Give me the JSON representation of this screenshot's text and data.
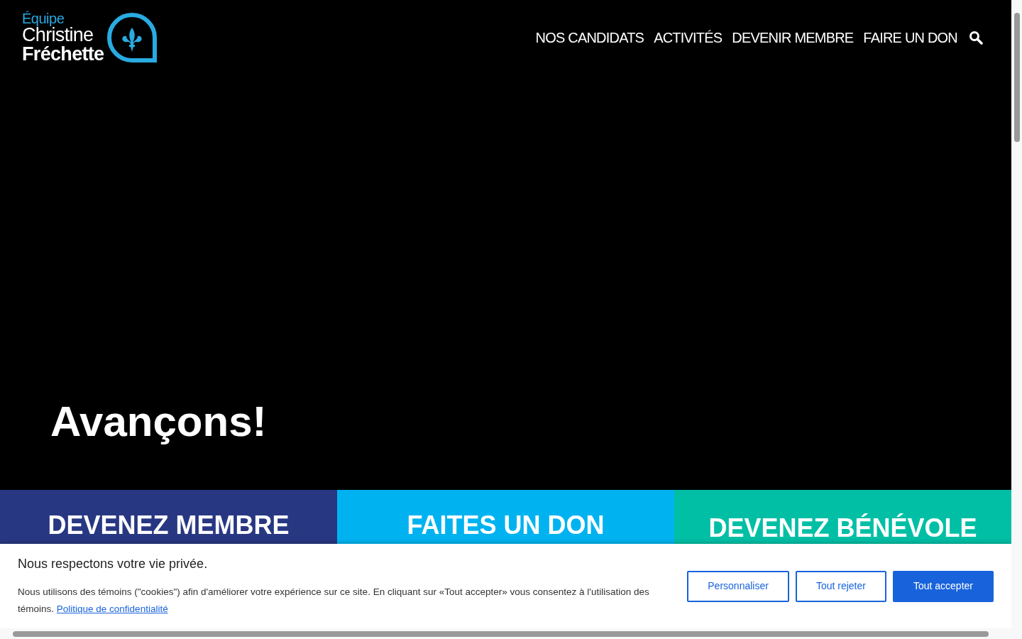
{
  "logo": {
    "line_1": "Équipe",
    "line_2": "Christine",
    "line_3": "Fréchette"
  },
  "nav": [
    "NOS CANDIDATS",
    "ACTIVITÉS",
    "DEVENIR MEMBRE",
    "FAIRE UN DON"
  ],
  "hero": {
    "title": "Avançons!"
  },
  "tiles": [
    {
      "label": "DEVENEZ MEMBRE",
      "color": "#283782"
    },
    {
      "label": "FAITES UN DON",
      "color": "#00b3f0"
    },
    {
      "label": "DEVENEZ BÉNÉVOLE",
      "color": "#00bfa5"
    }
  ],
  "cookie_banner": {
    "title": "Nous respectons votre vie privée.",
    "text": "Nous utilisons des témoins (\"cookies\") afin d'améliorer votre expérience sur ce site. En cliquant sur «Tout accepter» vous consentez à l'utilisation des témoins.",
    "link": "Politique de confidentialité",
    "buttons": [
      {
        "label": "Personnaliser",
        "kind": "outline"
      },
      {
        "label": "Tout rejeter",
        "kind": "outline"
      },
      {
        "label": "Tout accepter",
        "kind": "primary"
      }
    ]
  }
}
